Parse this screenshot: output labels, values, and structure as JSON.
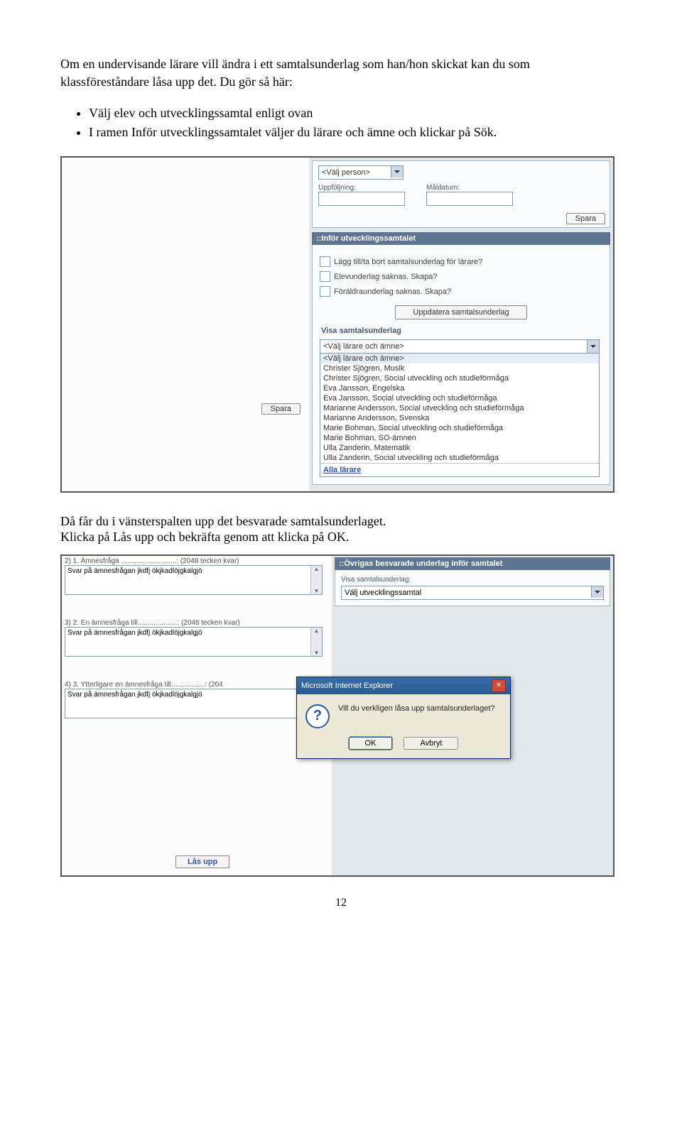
{
  "intro": "Om en undervisande lärare vill ändra i ett samtalsunderlag som han/hon skickat kan du som klassföreståndare låsa upp det. Du gör så här:",
  "bullets": [
    "Välj elev och utvecklingssamtal enligt ovan",
    "I ramen Inför utvecklingssamtalet väljer du lärare och ämne och klickar på Sök."
  ],
  "shot1": {
    "spara_left": "Spara",
    "top": {
      "valj_person": "<Välj person>",
      "uppfoljning": "Uppföljning:",
      "maldatum": "Måldatum:",
      "spara": "Spara"
    },
    "panel_header": "::Inför utvecklingssamtalet",
    "checks": [
      "Lägg till/ta bort samtalsunderlag för lärare?",
      "Elevunderlag saknas. Skapa?",
      "Föräldraunderlag saknas. Skapa?"
    ],
    "uppdatera": "Uppdatera samtalsunderlag",
    "visa_label": "Visa samtalsunderlag",
    "dd_selected": "<Välj lärare och ämne>",
    "dd_options": [
      "<Välj lärare och ämne>",
      "Christer Sjögren, Musik",
      "Christer Sjögren, Social utveckling och studieförmåga",
      "Eva Jansson, Engelska",
      "Eva Jansson, Social utveckling och studieförmåga",
      "Marianne Andersson, Social utveckling och studieförmåga",
      "Marianne Andersson, Svenska",
      "Marie Bohman, Social utveckling och studieförmåga",
      "Marie Bohman, SO-ämnen",
      "Ulla Zanderin, Matematik",
      "Ulla Zanderin, Social utveckling och studieförmåga"
    ],
    "alla_larare": "Alla lärare"
  },
  "mid": {
    "line1": "Då får du i vänsterspalten upp det besvarade samtalsunderlaget.",
    "line2": "Klicka på Lås upp och bekräfta genom att klicka på OK."
  },
  "shot2": {
    "qa": [
      {
        "label": "2) 1. Ämnesfråga ............................: (2048 tecken kvar)",
        "answer": "Svar på ämnesfrågan jkdfj ökjkadlöjgkalgjö"
      },
      {
        "label": "3) 2. En ämnesfråga till....................: (2048 tecken kvar)",
        "answer": "Svar på ämnesfrågan jkdfj ökjkadlöjgkalgjö"
      },
      {
        "label": "4) 3. Ytterligare en ämnesfråga till.................: (204",
        "answer": "Svar på ämnesfrågan jkdfj ökjkadlöjgkalgjö"
      }
    ],
    "las_upp": "Lås upp",
    "ovr_header": "::Övrigas besvarade underlag inför samtalet",
    "ovr_label": "Visa samtalsunderlag:",
    "ovr_select": "Välj utvecklingssamtal",
    "dialog": {
      "title": "Microsoft Internet Explorer",
      "msg": "Vill du verkligen låsa upp samtalsunderlaget?",
      "ok": "OK",
      "cancel": "Avbryt"
    }
  },
  "page_num": "12"
}
